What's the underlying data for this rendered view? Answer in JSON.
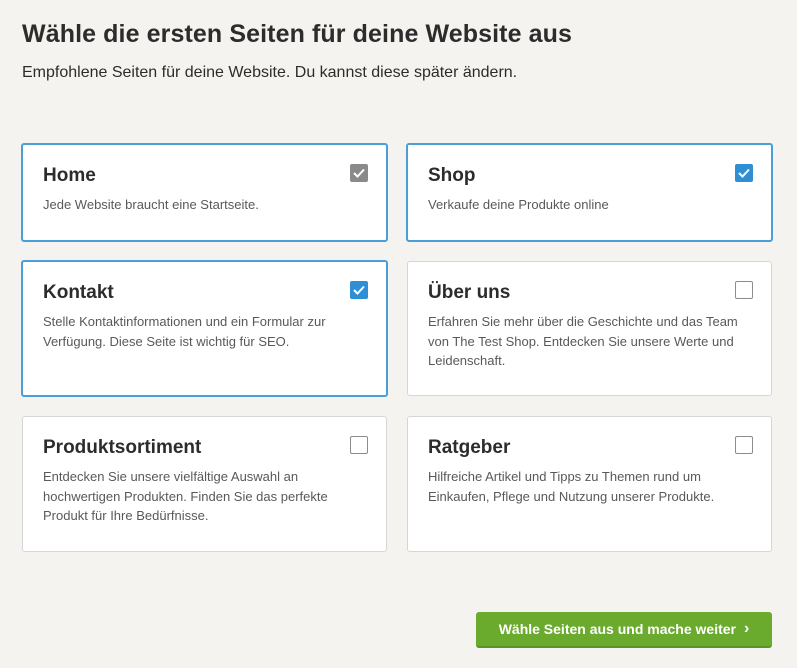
{
  "header": {
    "title": "Wähle die ersten Seiten für deine Website aus",
    "subtitle": "Empfohlene Seiten für deine Website. Du kannst diese später ändern."
  },
  "pages": [
    {
      "title": "Home",
      "description": "Jede Website braucht eine Startseite.",
      "checked": true,
      "locked": true
    },
    {
      "title": "Shop",
      "description": "Verkaufe deine Produkte online",
      "checked": true,
      "locked": false
    },
    {
      "title": "Kontakt",
      "description": "Stelle Kontaktinformationen und ein Formular zur Verfügung. Diese Seite ist wichtig für SEO.",
      "checked": true,
      "locked": false
    },
    {
      "title": "Über uns",
      "description": "Erfahren Sie mehr über die Geschichte und das Team von The Test Shop. Entdecken Sie unsere Werte und Leidenschaft.",
      "checked": false,
      "locked": false
    },
    {
      "title": "Produktsortiment",
      "description": "Entdecken Sie unsere vielfältige Auswahl an hochwertigen Produkten. Finden Sie das perfekte Produkt für Ihre Bedürfnisse.",
      "checked": false,
      "locked": false
    },
    {
      "title": "Ratgeber",
      "description": "Hilfreiche Artikel und Tipps zu Themen rund um Einkaufen, Pflege und Nutzung unserer Produkte.",
      "checked": false,
      "locked": false
    }
  ],
  "footer": {
    "continue_label": "Wähle Seiten aus und mache weiter",
    "continue_icon": "chevron-right-icon"
  },
  "colors": {
    "background": "#f4f3ef",
    "selected_border": "#4a9fd8",
    "checkbox_checked": "#2f8fd4",
    "checkbox_locked": "#8a8a8a",
    "primary_button": "#6aaa2c"
  }
}
